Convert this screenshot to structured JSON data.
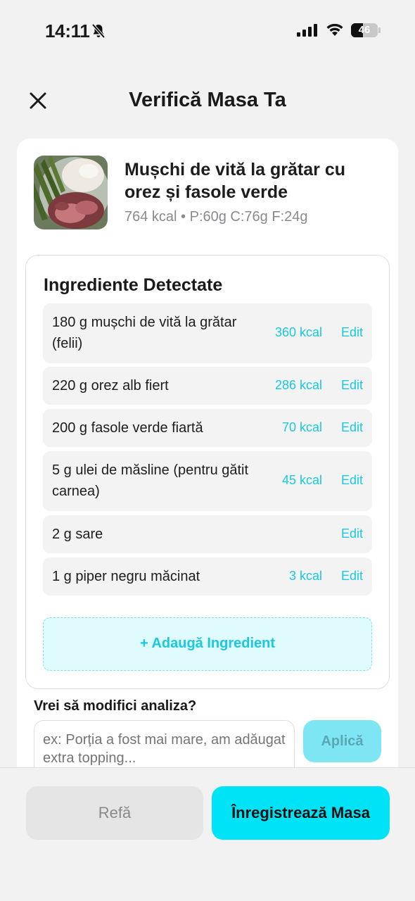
{
  "status_bar": {
    "time": "14:11",
    "battery_percent": "46",
    "battery_level": 0.46,
    "icons": [
      "bell-slash-icon",
      "signal-icon",
      "wifi-icon",
      "battery-icon"
    ]
  },
  "header": {
    "title": "Verifică Masa Ta",
    "close_icon": "close-icon"
  },
  "meal": {
    "name": "Mușchi de vită la grătar cu orez și fasole verde",
    "macros": "764 kcal • P:60g C:76g F:24g"
  },
  "ingredients": {
    "title": "Ingrediente Detectate",
    "edit_label": "Edit",
    "items": [
      {
        "name": "180 g mușchi de vită la grătar (felii)",
        "kcal": "360 kcal"
      },
      {
        "name": "220 g orez alb fiert",
        "kcal": "286 kcal"
      },
      {
        "name": "200 g fasole verde fiartă",
        "kcal": "70 kcal"
      },
      {
        "name": "5 g ulei de măsline (pentru gătit carnea)",
        "kcal": "45 kcal"
      },
      {
        "name": "2 g sare",
        "kcal": ""
      },
      {
        "name": "1 g piper negru măcinat",
        "kcal": "3 kcal"
      }
    ],
    "add_label": "+ Adaugă Ingredient"
  },
  "modify": {
    "label": "Vrei să modifici analiza?",
    "placeholder": "ex: Porția a fost mai mare, am adăugat extra topping...",
    "apply_label": "Aplică"
  },
  "actions": {
    "redo_label": "Refă",
    "log_label": "Înregistrează Masa"
  },
  "colors": {
    "accent": "#00e3f6",
    "accent_text": "#18c9e0",
    "background": "#f2f2f2"
  }
}
